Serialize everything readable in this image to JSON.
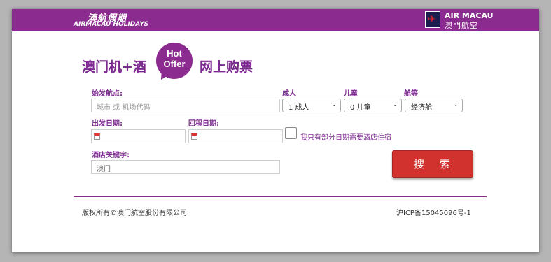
{
  "header": {
    "left_brand_cn": "澳航假期",
    "left_brand_en": "AIRMACAU HOLIDAYS",
    "right_brand_en": "AIR MACAU",
    "right_brand_cn": "澳門航空",
    "bar_color": "#8b2a8f"
  },
  "promo": {
    "title_left": "澳门机+酒",
    "badge_line1": "Hot",
    "badge_line2": "Offer",
    "title_right": "网上购票"
  },
  "form": {
    "origin_label": "始发航点:",
    "origin_placeholder": "城市 或 机场代码",
    "adult_label": "成人",
    "adult_value": "1 成人",
    "child_label": "儿童",
    "child_value": "0 儿童",
    "cabin_label": "舱等",
    "cabin_value": "经济舱",
    "depart_label": "出发日期:",
    "return_label": "回程日期:",
    "partial_hotel_label": "我只有部分日期需要酒店住宿",
    "hotel_label": "酒店关键字:",
    "hotel_value": "澳门",
    "search_label": "搜索"
  },
  "footer": {
    "copyright": "版权所有©澳门航空股份有限公司",
    "icp": "沪ICP备15045096号-1"
  },
  "colors": {
    "accent": "#7b2a8f",
    "search_button": "#d2322d"
  }
}
